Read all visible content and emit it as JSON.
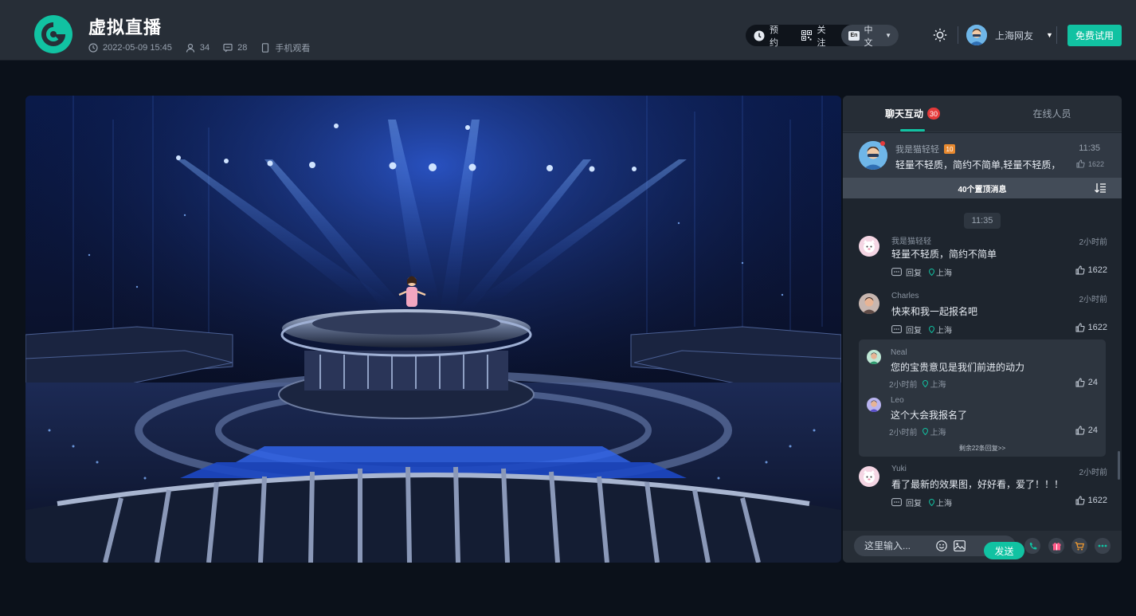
{
  "header": {
    "title": "虚拟直播",
    "datetime": "2022-05-09 15:45",
    "viewers": "34",
    "comments": "28",
    "mobile_watch": "手机观看",
    "reserve_label": "预约",
    "follow_label": "关注",
    "lang_badge": "En",
    "lang_label": "中文",
    "username": "上海网友",
    "trial_button": "免费试用"
  },
  "colors": {
    "accent": "#11c2a2",
    "badge_red": "#e53a3a",
    "level_orange": "#e8892f"
  },
  "icons": [
    "logo-icon",
    "clock-icon",
    "user-icon",
    "comment-icon",
    "phone-icon",
    "bell-icon",
    "qrcode-icon",
    "sun-icon",
    "caret-icon",
    "like-icon",
    "location-icon",
    "reply-icon",
    "sort-icon",
    "emoji-icon",
    "image-icon",
    "call-icon",
    "gift-icon",
    "cart-icon",
    "more-icon"
  ],
  "chat": {
    "tabs": [
      {
        "label": "聊天互动",
        "badge": "30"
      },
      {
        "label": "在线人员"
      }
    ],
    "pinned": {
      "name": "我是猫轻轻",
      "level": "10",
      "time": "11:35",
      "text": "轻量不轻质，简约不简单,轻量不轻质，",
      "likes": "1622",
      "bar_label": "40个置顶消息"
    },
    "time_divider": "11:35",
    "messages": [
      {
        "name": "我是猫轻轻",
        "time": "2小时前",
        "text": "轻量不轻质，简约不简单",
        "reply": "回复",
        "location": "上海",
        "likes": "1622"
      },
      {
        "name": "Charles",
        "time": "2小时前",
        "text": "快来和我一起报名吧",
        "reply": "回复",
        "location": "上海",
        "likes": "1622"
      },
      {
        "name": "Yuki",
        "time": "2小时前",
        "text": "看了最新的效果图，好好看，爱了！！！",
        "reply": "回复",
        "location": "上海",
        "likes": "1622"
      }
    ],
    "replies": [
      {
        "name": "Neal",
        "text": "您的宝贵意见是我们前进的动力",
        "time": "2小时前",
        "location": "上海",
        "likes": "24"
      },
      {
        "name": "Leo",
        "text": "这个大会我报名了",
        "time": "2小时前",
        "location": "上海",
        "likes": "24"
      }
    ],
    "more_replies": "剩余22条回复>>",
    "input_placeholder": "这里输入...",
    "send_label": "发送"
  }
}
